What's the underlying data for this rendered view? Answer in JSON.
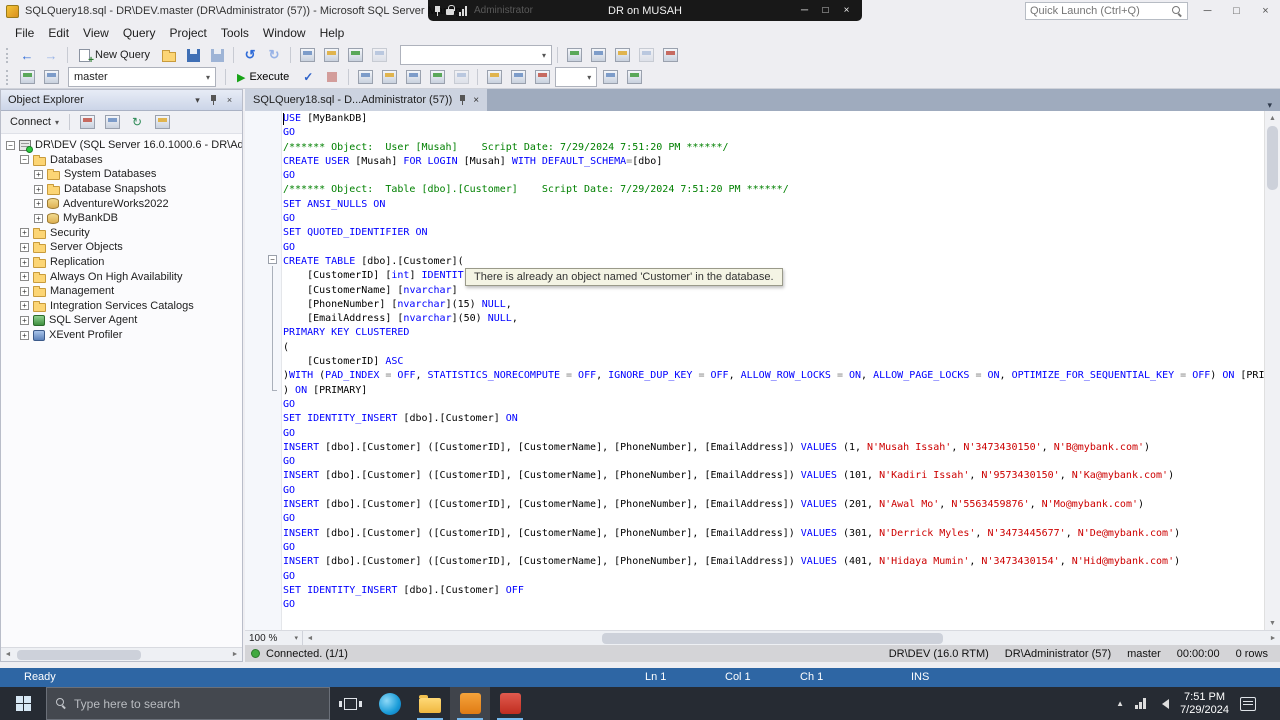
{
  "colors": {
    "keyword": "#0000ff",
    "comment": "#008000",
    "string": "#cc0000",
    "operator": "#808080",
    "status_blue": "#2e66a4",
    "execute_green": "#17a317",
    "taskbar_bg": "#262b33"
  },
  "icons": {
    "close": "×",
    "minimize": "─",
    "maximize": "□",
    "chevron_down": "▾",
    "caret_up": "▲",
    "caret_down": "▼",
    "caret_left": "◄",
    "caret_right": "►",
    "back": "←",
    "forward": "→",
    "undo": "↺",
    "redo": "↻",
    "refresh": "↻",
    "check": "✓",
    "play": "▶",
    "minus": "−"
  },
  "rdp_bar": {
    "title": "DR on MUSAH",
    "faint_text": "Administrator"
  },
  "title_bar": {
    "app_title": "SQLQuery18.sql - DR\\DEV.master (DR\\Administrator (57)) - Microsoft SQL Server Manag...",
    "quick_launch_placeholder": "Quick Launch (Ctrl+Q)"
  },
  "menu_bar": {
    "items": [
      "File",
      "Edit",
      "View",
      "Query",
      "Project",
      "Tools",
      "Window",
      "Help"
    ]
  },
  "toolbar_standard": {
    "new_query_label": "New Query"
  },
  "toolbar_sql": {
    "database_dropdown": "master",
    "execute_label": "Execute"
  },
  "object_explorer": {
    "title": "Object Explorer",
    "connect_label": "Connect",
    "tree": [
      {
        "label": "DR\\DEV (SQL Server 16.0.1000.6 - DR\\Administrator)",
        "level": 0,
        "expand": "-",
        "icon": "server"
      },
      {
        "label": "Databases",
        "level": 1,
        "expand": "-",
        "icon": "folder"
      },
      {
        "label": "System Databases",
        "level": 2,
        "expand": "+",
        "icon": "folder"
      },
      {
        "label": "Database Snapshots",
        "level": 2,
        "expand": "+",
        "icon": "folder"
      },
      {
        "label": "AdventureWorks2022",
        "level": 2,
        "expand": "+",
        "icon": "database"
      },
      {
        "label": "MyBankDB",
        "level": 2,
        "expand": "+",
        "icon": "database"
      },
      {
        "label": "Security",
        "level": 1,
        "expand": "+",
        "icon": "folder"
      },
      {
        "label": "Server Objects",
        "level": 1,
        "expand": "+",
        "icon": "folder"
      },
      {
        "label": "Replication",
        "level": 1,
        "expand": "+",
        "icon": "folder"
      },
      {
        "label": "Always On High Availability",
        "level": 1,
        "expand": "+",
        "icon": "folder"
      },
      {
        "label": "Management",
        "level": 1,
        "expand": "+",
        "icon": "folder"
      },
      {
        "label": "Integration Services Catalogs",
        "level": 1,
        "expand": "+",
        "icon": "folder"
      },
      {
        "label": "SQL Server Agent",
        "level": 1,
        "expand": "+",
        "icon": "agent"
      },
      {
        "label": "XEvent Profiler",
        "level": 1,
        "expand": "+",
        "icon": "profiler"
      }
    ]
  },
  "editor": {
    "tab_label": "SQLQuery18.sql - D...Administrator (57))",
    "zoom": "100 %",
    "tooltip": "There is already an object named 'Customer' in the database.",
    "lines": [
      [
        [
          "k",
          "USE "
        ],
        [
          "n",
          "[MyBankDB]"
        ]
      ],
      [
        [
          "k",
          "GO"
        ]
      ],
      [
        [
          "c",
          "/****** Object:  User [Musah]    Script Date: 7/29/2024 7:51:20 PM ******/"
        ]
      ],
      [
        [
          "k",
          "CREATE USER "
        ],
        [
          "n",
          "[Musah] "
        ],
        [
          "k",
          "FOR LOGIN "
        ],
        [
          "n",
          "[Musah] "
        ],
        [
          "k",
          "WITH DEFAULT_SCHEMA"
        ],
        [
          "o",
          "="
        ],
        [
          "n",
          "[dbo]"
        ]
      ],
      [
        [
          "k",
          "GO"
        ]
      ],
      [
        [
          "c",
          "/****** Object:  Table [dbo].[Customer]    Script Date: 7/29/2024 7:51:20 PM ******/"
        ]
      ],
      [
        [
          "k",
          "SET ANSI_NULLS ON"
        ]
      ],
      [
        [
          "k",
          "GO"
        ]
      ],
      [
        [
          "k",
          "SET QUOTED_IDENTIFIER ON"
        ]
      ],
      [
        [
          "k",
          "GO"
        ]
      ],
      [
        [
          "k",
          "CREATE TABLE "
        ],
        [
          "n",
          "[dbo].[Customer]("
        ]
      ],
      [
        [
          "n",
          "    [CustomerID] ["
        ],
        [
          "k",
          "int"
        ],
        [
          "n",
          "] "
        ],
        [
          "k",
          "IDENTIT"
        ]
      ],
      [
        [
          "n",
          "    [CustomerName] ["
        ],
        [
          "k",
          "nvarchar"
        ],
        [
          "n",
          "]"
        ]
      ],
      [
        [
          "n",
          "    [PhoneNumber] ["
        ],
        [
          "k",
          "nvarchar"
        ],
        [
          "n",
          "](15) "
        ],
        [
          "k",
          "NULL"
        ],
        [
          "n",
          ","
        ]
      ],
      [
        [
          "n",
          "    [EmailAddress] ["
        ],
        [
          "k",
          "nvarchar"
        ],
        [
          "n",
          "](50) "
        ],
        [
          "k",
          "NULL"
        ],
        [
          "n",
          ","
        ]
      ],
      [
        [
          "k",
          "PRIMARY KEY CLUSTERED"
        ]
      ],
      [
        [
          "n",
          "("
        ]
      ],
      [
        [
          "n",
          "    [CustomerID] "
        ],
        [
          "k",
          "ASC"
        ]
      ],
      [
        [
          "n",
          ")"
        ],
        [
          "k",
          "WITH"
        ],
        [
          "n",
          " ("
        ],
        [
          "k",
          "PAD_INDEX"
        ],
        [
          "o",
          " = "
        ],
        [
          "k",
          "OFF"
        ],
        [
          "n",
          ", "
        ],
        [
          "k",
          "STATISTICS_NORECOMPUTE"
        ],
        [
          "o",
          " = "
        ],
        [
          "k",
          "OFF"
        ],
        [
          "n",
          ", "
        ],
        [
          "k",
          "IGNORE_DUP_KEY"
        ],
        [
          "o",
          " = "
        ],
        [
          "k",
          "OFF"
        ],
        [
          "n",
          ", "
        ],
        [
          "k",
          "ALLOW_ROW_LOCKS"
        ],
        [
          "o",
          " = "
        ],
        [
          "k",
          "ON"
        ],
        [
          "n",
          ", "
        ],
        [
          "k",
          "ALLOW_PAGE_LOCKS"
        ],
        [
          "o",
          " = "
        ],
        [
          "k",
          "ON"
        ],
        [
          "n",
          ", "
        ],
        [
          "k",
          "OPTIMIZE_FOR_SEQUENTIAL_KEY"
        ],
        [
          "o",
          " = "
        ],
        [
          "k",
          "OFF"
        ],
        [
          "n",
          ") "
        ],
        [
          "k",
          "ON"
        ],
        [
          "n",
          " [PRIMARY]"
        ]
      ],
      [
        [
          "n",
          ") "
        ],
        [
          "k",
          "ON"
        ],
        [
          "n",
          " [PRIMARY]"
        ]
      ],
      [
        [
          "k",
          "GO"
        ]
      ],
      [
        [
          "k",
          "SET IDENTITY_INSERT "
        ],
        [
          "n",
          "[dbo].[Customer] "
        ],
        [
          "k",
          "ON"
        ]
      ],
      [
        [
          "k",
          "GO"
        ]
      ],
      [
        [
          "k",
          "INSERT "
        ],
        [
          "n",
          "[dbo].[Customer] ([CustomerID], [CustomerName], [PhoneNumber], [EmailAddress]) "
        ],
        [
          "k",
          "VALUES "
        ],
        [
          "n",
          "(1, "
        ],
        [
          "s",
          "N'Musah Issah'"
        ],
        [
          "n",
          ", "
        ],
        [
          "s",
          "N'3473430150'"
        ],
        [
          "n",
          ", "
        ],
        [
          "s",
          "N'B@mybank.com'"
        ],
        [
          "n",
          ")"
        ]
      ],
      [
        [
          "k",
          "GO"
        ]
      ],
      [
        [
          "k",
          "INSERT "
        ],
        [
          "n",
          "[dbo].[Customer] ([CustomerID], [CustomerName], [PhoneNumber], [EmailAddress]) "
        ],
        [
          "k",
          "VALUES "
        ],
        [
          "n",
          "(101, "
        ],
        [
          "s",
          "N'Kadiri Issah'"
        ],
        [
          "n",
          ", "
        ],
        [
          "s",
          "N'9573430150'"
        ],
        [
          "n",
          ", "
        ],
        [
          "s",
          "N'Ka@mybank.com'"
        ],
        [
          "n",
          ")"
        ]
      ],
      [
        [
          "k",
          "GO"
        ]
      ],
      [
        [
          "k",
          "INSERT "
        ],
        [
          "n",
          "[dbo].[Customer] ([CustomerID], [CustomerName], [PhoneNumber], [EmailAddress]) "
        ],
        [
          "k",
          "VALUES "
        ],
        [
          "n",
          "(201, "
        ],
        [
          "s",
          "N'Awal Mo'"
        ],
        [
          "n",
          ", "
        ],
        [
          "s",
          "N'5563459876'"
        ],
        [
          "n",
          ", "
        ],
        [
          "s",
          "N'Mo@mybank.com'"
        ],
        [
          "n",
          ")"
        ]
      ],
      [
        [
          "k",
          "GO"
        ]
      ],
      [
        [
          "k",
          "INSERT "
        ],
        [
          "n",
          "[dbo].[Customer] ([CustomerID], [CustomerName], [PhoneNumber], [EmailAddress]) "
        ],
        [
          "k",
          "VALUES "
        ],
        [
          "n",
          "(301, "
        ],
        [
          "s",
          "N'Derrick Myles'"
        ],
        [
          "n",
          ", "
        ],
        [
          "s",
          "N'3473445677'"
        ],
        [
          "n",
          ", "
        ],
        [
          "s",
          "N'De@mybank.com'"
        ],
        [
          "n",
          ")"
        ]
      ],
      [
        [
          "k",
          "GO"
        ]
      ],
      [
        [
          "k",
          "INSERT "
        ],
        [
          "n",
          "[dbo].[Customer] ([CustomerID], [CustomerName], [PhoneNumber], [EmailAddress]) "
        ],
        [
          "k",
          "VALUES "
        ],
        [
          "n",
          "(401, "
        ],
        [
          "s",
          "N'Hidaya Mumin'"
        ],
        [
          "n",
          ", "
        ],
        [
          "s",
          "N'3473430154'"
        ],
        [
          "n",
          ", "
        ],
        [
          "s",
          "N'Hid@mybank.com'"
        ],
        [
          "n",
          ")"
        ]
      ],
      [
        [
          "k",
          "GO"
        ]
      ],
      [
        [
          "k",
          "SET IDENTITY_INSERT "
        ],
        [
          "n",
          "[dbo].[Customer] "
        ],
        [
          "k",
          "OFF"
        ]
      ],
      [
        [
          "k",
          "GO"
        ]
      ]
    ]
  },
  "status_bar": {
    "connection": "Connected. (1/1)",
    "server": "DR\\DEV (16.0 RTM)",
    "login": "DR\\Administrator (57)",
    "database": "master",
    "duration": "00:00:00",
    "rows": "0 rows"
  },
  "app_status": {
    "ready": "Ready",
    "line": "Ln 1",
    "column": "Col 1",
    "char": "Ch 1",
    "mode": "INS"
  },
  "taskbar": {
    "search_placeholder": "Type here to search",
    "time": "7:51 PM",
    "date": "7/29/2024"
  }
}
